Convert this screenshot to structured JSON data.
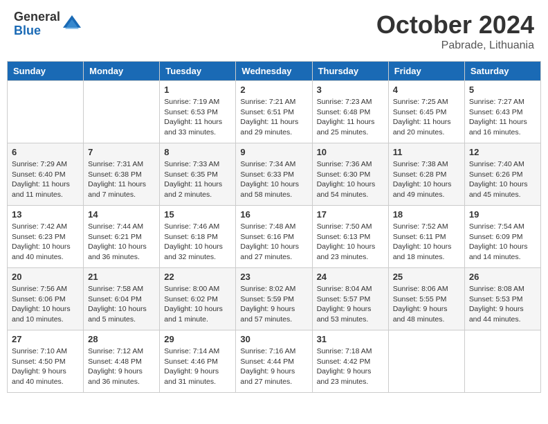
{
  "header": {
    "logo_general": "General",
    "logo_blue": "Blue",
    "month": "October 2024",
    "location": "Pabrade, Lithuania"
  },
  "weekdays": [
    "Sunday",
    "Monday",
    "Tuesday",
    "Wednesday",
    "Thursday",
    "Friday",
    "Saturday"
  ],
  "weeks": [
    [
      {
        "day": "",
        "info": ""
      },
      {
        "day": "",
        "info": ""
      },
      {
        "day": "1",
        "info": "Sunrise: 7:19 AM\nSunset: 6:53 PM\nDaylight: 11 hours and 33 minutes."
      },
      {
        "day": "2",
        "info": "Sunrise: 7:21 AM\nSunset: 6:51 PM\nDaylight: 11 hours and 29 minutes."
      },
      {
        "day": "3",
        "info": "Sunrise: 7:23 AM\nSunset: 6:48 PM\nDaylight: 11 hours and 25 minutes."
      },
      {
        "day": "4",
        "info": "Sunrise: 7:25 AM\nSunset: 6:45 PM\nDaylight: 11 hours and 20 minutes."
      },
      {
        "day": "5",
        "info": "Sunrise: 7:27 AM\nSunset: 6:43 PM\nDaylight: 11 hours and 16 minutes."
      }
    ],
    [
      {
        "day": "6",
        "info": "Sunrise: 7:29 AM\nSunset: 6:40 PM\nDaylight: 11 hours and 11 minutes."
      },
      {
        "day": "7",
        "info": "Sunrise: 7:31 AM\nSunset: 6:38 PM\nDaylight: 11 hours and 7 minutes."
      },
      {
        "day": "8",
        "info": "Sunrise: 7:33 AM\nSunset: 6:35 PM\nDaylight: 11 hours and 2 minutes."
      },
      {
        "day": "9",
        "info": "Sunrise: 7:34 AM\nSunset: 6:33 PM\nDaylight: 10 hours and 58 minutes."
      },
      {
        "day": "10",
        "info": "Sunrise: 7:36 AM\nSunset: 6:30 PM\nDaylight: 10 hours and 54 minutes."
      },
      {
        "day": "11",
        "info": "Sunrise: 7:38 AM\nSunset: 6:28 PM\nDaylight: 10 hours and 49 minutes."
      },
      {
        "day": "12",
        "info": "Sunrise: 7:40 AM\nSunset: 6:26 PM\nDaylight: 10 hours and 45 minutes."
      }
    ],
    [
      {
        "day": "13",
        "info": "Sunrise: 7:42 AM\nSunset: 6:23 PM\nDaylight: 10 hours and 40 minutes."
      },
      {
        "day": "14",
        "info": "Sunrise: 7:44 AM\nSunset: 6:21 PM\nDaylight: 10 hours and 36 minutes."
      },
      {
        "day": "15",
        "info": "Sunrise: 7:46 AM\nSunset: 6:18 PM\nDaylight: 10 hours and 32 minutes."
      },
      {
        "day": "16",
        "info": "Sunrise: 7:48 AM\nSunset: 6:16 PM\nDaylight: 10 hours and 27 minutes."
      },
      {
        "day": "17",
        "info": "Sunrise: 7:50 AM\nSunset: 6:13 PM\nDaylight: 10 hours and 23 minutes."
      },
      {
        "day": "18",
        "info": "Sunrise: 7:52 AM\nSunset: 6:11 PM\nDaylight: 10 hours and 18 minutes."
      },
      {
        "day": "19",
        "info": "Sunrise: 7:54 AM\nSunset: 6:09 PM\nDaylight: 10 hours and 14 minutes."
      }
    ],
    [
      {
        "day": "20",
        "info": "Sunrise: 7:56 AM\nSunset: 6:06 PM\nDaylight: 10 hours and 10 minutes."
      },
      {
        "day": "21",
        "info": "Sunrise: 7:58 AM\nSunset: 6:04 PM\nDaylight: 10 hours and 5 minutes."
      },
      {
        "day": "22",
        "info": "Sunrise: 8:00 AM\nSunset: 6:02 PM\nDaylight: 10 hours and 1 minute."
      },
      {
        "day": "23",
        "info": "Sunrise: 8:02 AM\nSunset: 5:59 PM\nDaylight: 9 hours and 57 minutes."
      },
      {
        "day": "24",
        "info": "Sunrise: 8:04 AM\nSunset: 5:57 PM\nDaylight: 9 hours and 53 minutes."
      },
      {
        "day": "25",
        "info": "Sunrise: 8:06 AM\nSunset: 5:55 PM\nDaylight: 9 hours and 48 minutes."
      },
      {
        "day": "26",
        "info": "Sunrise: 8:08 AM\nSunset: 5:53 PM\nDaylight: 9 hours and 44 minutes."
      }
    ],
    [
      {
        "day": "27",
        "info": "Sunrise: 7:10 AM\nSunset: 4:50 PM\nDaylight: 9 hours and 40 minutes."
      },
      {
        "day": "28",
        "info": "Sunrise: 7:12 AM\nSunset: 4:48 PM\nDaylight: 9 hours and 36 minutes."
      },
      {
        "day": "29",
        "info": "Sunrise: 7:14 AM\nSunset: 4:46 PM\nDaylight: 9 hours and 31 minutes."
      },
      {
        "day": "30",
        "info": "Sunrise: 7:16 AM\nSunset: 4:44 PM\nDaylight: 9 hours and 27 minutes."
      },
      {
        "day": "31",
        "info": "Sunrise: 7:18 AM\nSunset: 4:42 PM\nDaylight: 9 hours and 23 minutes."
      },
      {
        "day": "",
        "info": ""
      },
      {
        "day": "",
        "info": ""
      }
    ]
  ]
}
